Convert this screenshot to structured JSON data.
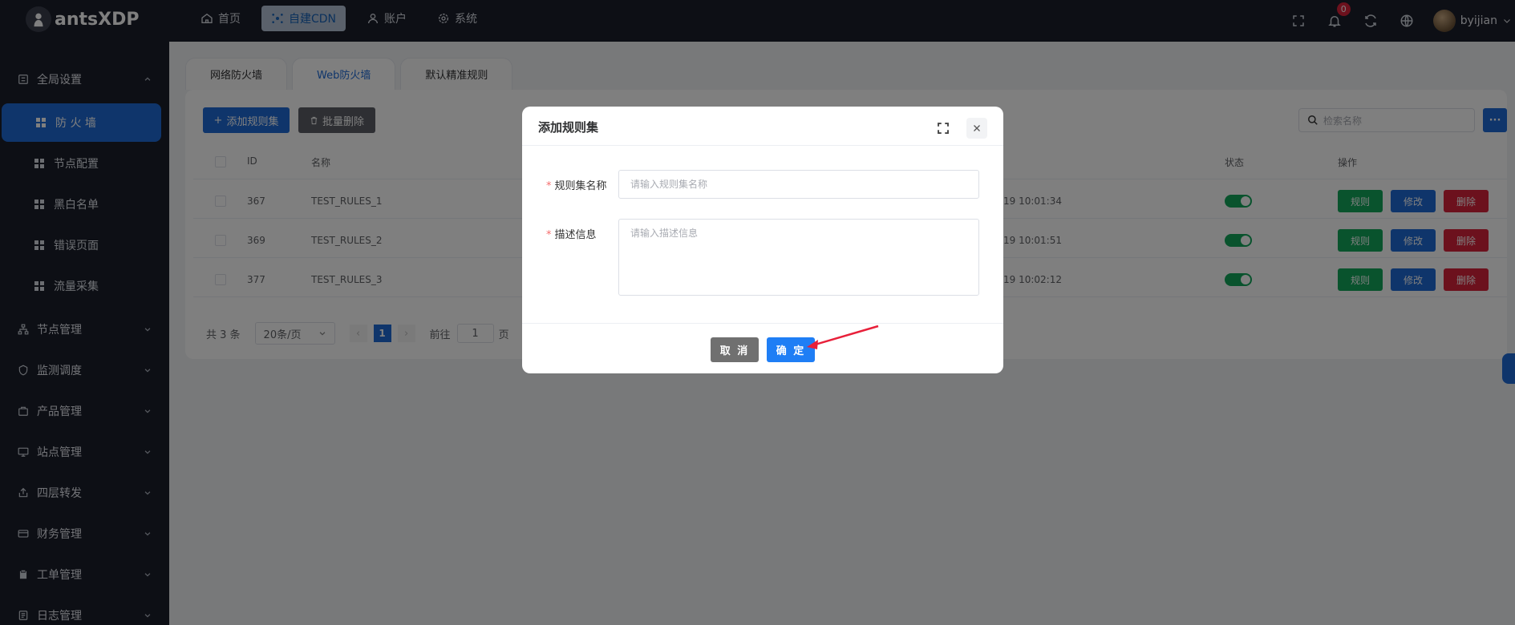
{
  "app": {
    "logo_text": "antsXDP"
  },
  "topnav": [
    {
      "label": "首页",
      "icon": "home-icon",
      "active": false
    },
    {
      "label": "自建CDN",
      "icon": "cdn-icon",
      "active": true
    },
    {
      "label": "账户",
      "icon": "user-icon",
      "active": false
    },
    {
      "label": "系统",
      "icon": "gear-icon",
      "active": false
    }
  ],
  "topbar": {
    "notification_count": "0",
    "username": "byijian"
  },
  "sidebar": {
    "group_global": "全局设置",
    "subitems": [
      "防 火 墙",
      "节点配置",
      "黑白名单",
      "错误页面",
      "流量采集"
    ],
    "groups": [
      "节点管理",
      "监测调度",
      "产品管理",
      "站点管理",
      "四层转发",
      "财务管理",
      "工单管理",
      "日志管理"
    ]
  },
  "tabs": [
    "网络防火墙",
    "Web防火墙",
    "默认精准规则"
  ],
  "toolbar": {
    "add_label": "添加规则集",
    "batch_delete_label": "批量删除",
    "search_placeholder": "检索名称",
    "more_label": "···"
  },
  "table": {
    "headers": {
      "id": "ID",
      "name": "名称",
      "status": "状态",
      "actions": "操作"
    },
    "rows": [
      {
        "id": "367",
        "name": "TEST_RULES_1",
        "time": "19 10:01:34",
        "enabled": true
      },
      {
        "id": "369",
        "name": "TEST_RULES_2",
        "time": "19 10:01:51",
        "enabled": true
      },
      {
        "id": "377",
        "name": "TEST_RULES_3",
        "time": "19 10:02:12",
        "enabled": true
      }
    ],
    "actions": {
      "rules": "规则",
      "edit": "修改",
      "delete": "删除"
    }
  },
  "pagination": {
    "total": "共 3 条",
    "page_size": "20条/页",
    "current_page": "1",
    "goto_prefix": "前往",
    "goto_value": "1",
    "goto_suffix": "页"
  },
  "dialog": {
    "title": "添加规则集",
    "name_label": "规则集名称",
    "name_placeholder": "请输入规则集名称",
    "desc_label": "描述信息",
    "desc_placeholder": "请输入描述信息",
    "cancel_label": "取 消",
    "confirm_label": "确 定"
  },
  "colors": {
    "primary": "#1f6bd6",
    "success": "#13a65b",
    "danger": "#d9233a",
    "dark": "#1b1f2b",
    "annotation": "#e8203a"
  }
}
